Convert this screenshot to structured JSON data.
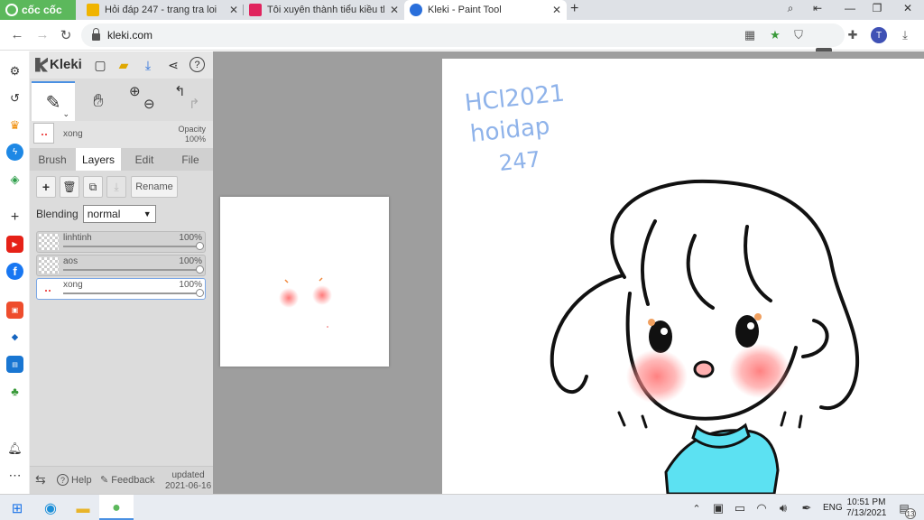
{
  "browser": {
    "brand": "cốc cốc",
    "tabs": [
      {
        "title": "Hỏi đáp 247 - trang tra loi",
        "color": "#f0b400"
      },
      {
        "title": "Tôi xuyên thành tiểu kiều thê",
        "color": "#e0245e"
      },
      {
        "title": "Kleki - Paint Tool",
        "color": "#2a6fdb",
        "active": true
      }
    ],
    "new_tab": "+",
    "url": "kleki.com",
    "profile_initial": "T"
  },
  "kleki": {
    "logo": "Kleki",
    "current_layer_name": "xong",
    "opacity_label": "Opacity",
    "opacity_value": "100%",
    "tabs": [
      "Brush",
      "Layers",
      "Edit",
      "File"
    ],
    "active_tab": "Layers",
    "rename_label": "Rename",
    "blending_label": "Blending",
    "blending_value": "normal",
    "layers": [
      {
        "name": "linhtinh",
        "opacity": "100%",
        "opacity_fraction": 1.0
      },
      {
        "name": "aos",
        "opacity": "100%",
        "opacity_fraction": 1.0
      },
      {
        "name": "xong",
        "opacity": "100%",
        "opacity_fraction": 1.0,
        "active": true
      }
    ],
    "footer": {
      "help": "Help",
      "feedback": "Feedback",
      "updated_label": "updated",
      "updated_date": "2021-06-16"
    }
  },
  "canvas": {
    "handwriting": [
      "HCl2021",
      "hoidap",
      "247"
    ]
  },
  "taskbar": {
    "language": "ENG",
    "time": "10:51 PM",
    "date": "7/13/2021",
    "notifications": "13"
  },
  "colors": {
    "accent": "#4a90e2",
    "sweater": "#5ce1f2",
    "blush": "#ff8a8a",
    "handwriting": "#8fb3ea"
  }
}
